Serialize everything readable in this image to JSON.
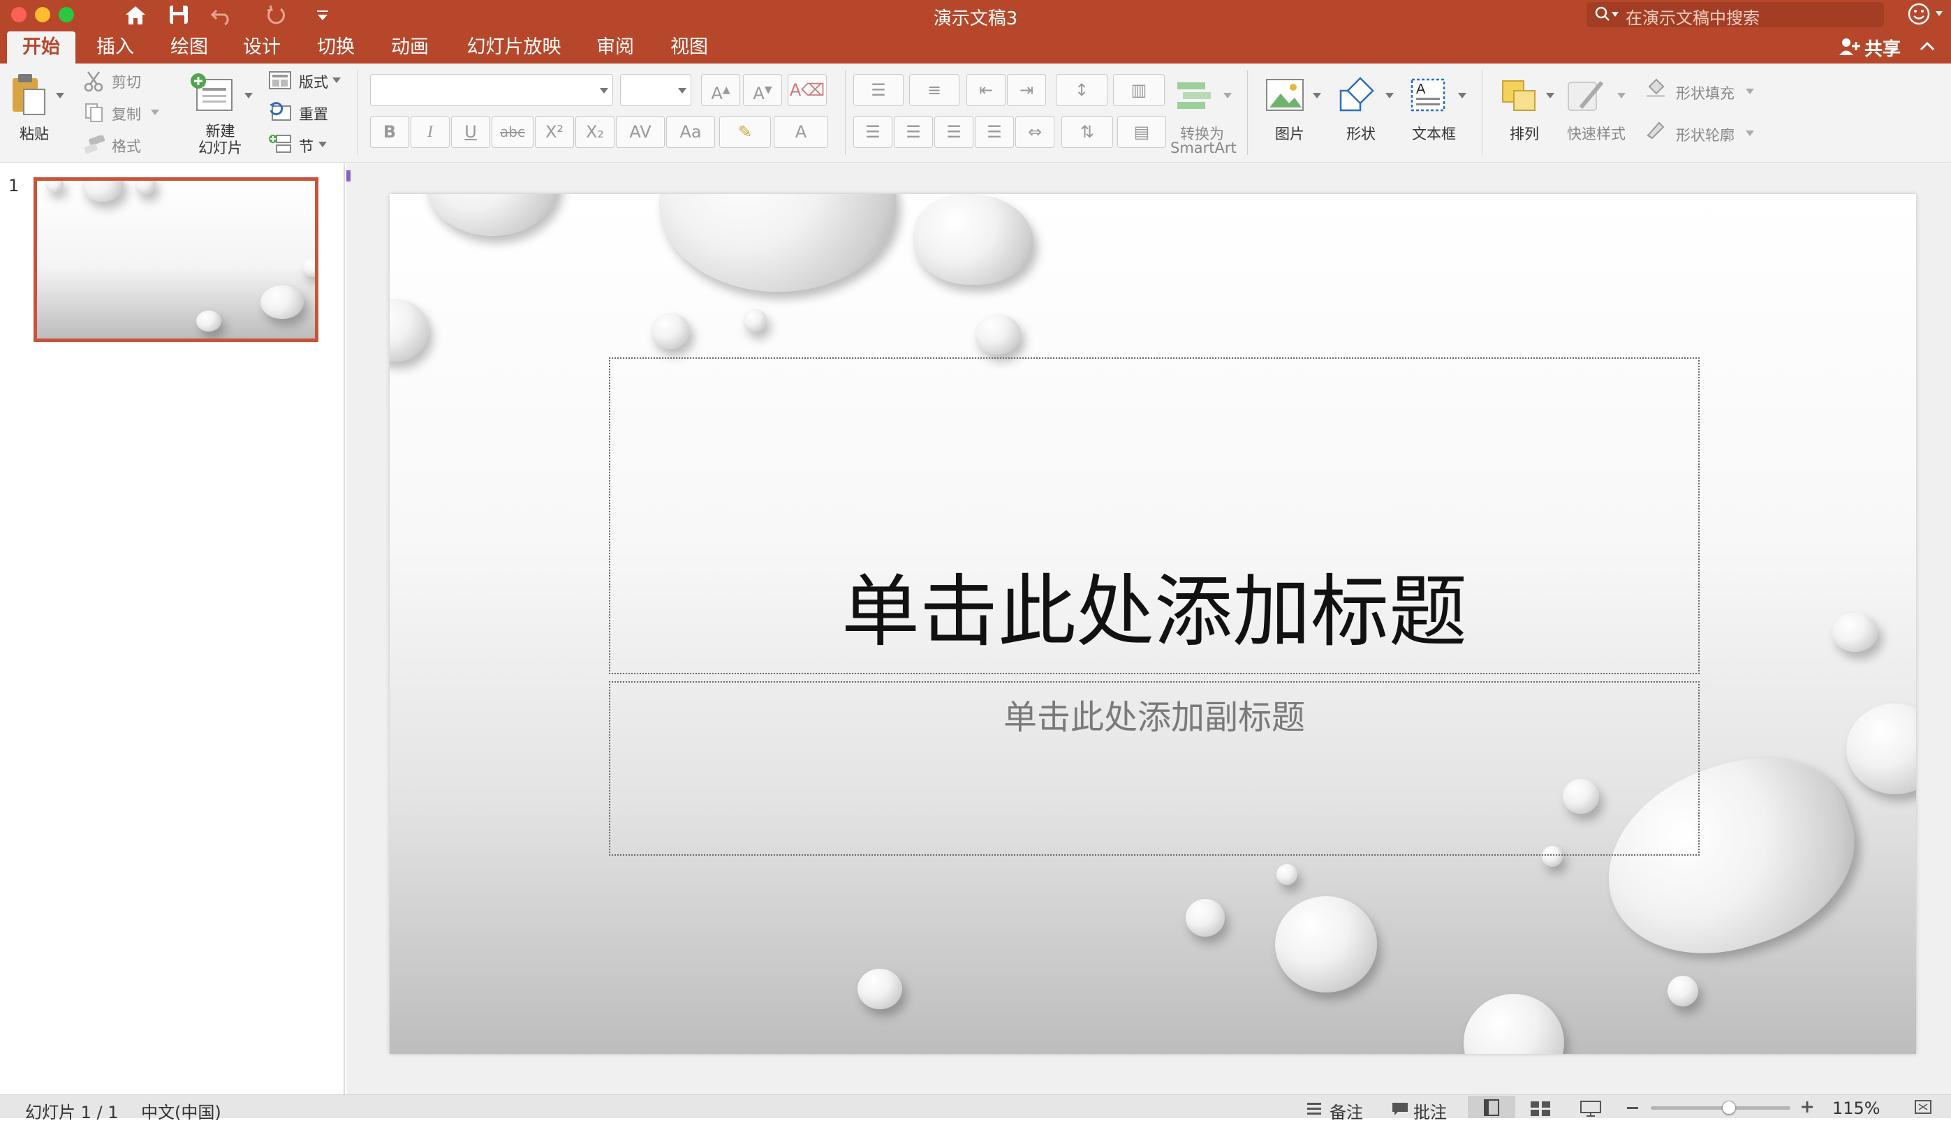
{
  "window": {
    "title": "演示文稿3",
    "search_placeholder": "在演示文稿中搜索"
  },
  "quick_access": [
    "home-icon",
    "save-icon",
    "undo-icon",
    "redo-icon",
    "customize-icon"
  ],
  "ribbon_tabs": [
    {
      "label": "开始",
      "active": true
    },
    {
      "label": "插入"
    },
    {
      "label": "绘图"
    },
    {
      "label": "设计"
    },
    {
      "label": "切换"
    },
    {
      "label": "动画"
    },
    {
      "label": "幻灯片放映"
    },
    {
      "label": "审阅"
    },
    {
      "label": "视图"
    }
  ],
  "share_label": "共享",
  "ribbon": {
    "paste": "粘贴",
    "cut": "剪切",
    "copy": "复制",
    "format": "格式",
    "new_slide": "新建\n幻灯片",
    "layout": "版式",
    "reset": "重置",
    "section": "节",
    "font_value": "",
    "size_value": "",
    "convert_smartart_1": "转换为",
    "convert_smartart_2": "SmartArt",
    "picture": "图片",
    "shapes": "形状",
    "textbox": "文本框",
    "arrange": "排列",
    "quick_styles": "快速样式",
    "shape_fill": "形状填充",
    "shape_outline": "形状轮廓",
    "font_buttons": [
      "B",
      "I",
      "U",
      "abc",
      "X²",
      "X₂",
      "AV",
      "Aa"
    ]
  },
  "thumbnails": [
    {
      "number": "1"
    }
  ],
  "slide": {
    "title_placeholder": "单击此处添加标题",
    "subtitle_placeholder": "单击此处添加副标题"
  },
  "status": {
    "slide_info": "幻灯片 1 / 1",
    "language": "中文(中国)",
    "notes": "备注",
    "comments": "批注",
    "zoom": "115%",
    "zoom_level": 0.56
  },
  "colors": {
    "accent": "#b7472a",
    "ribbon_bg": "#f3f3f3"
  }
}
